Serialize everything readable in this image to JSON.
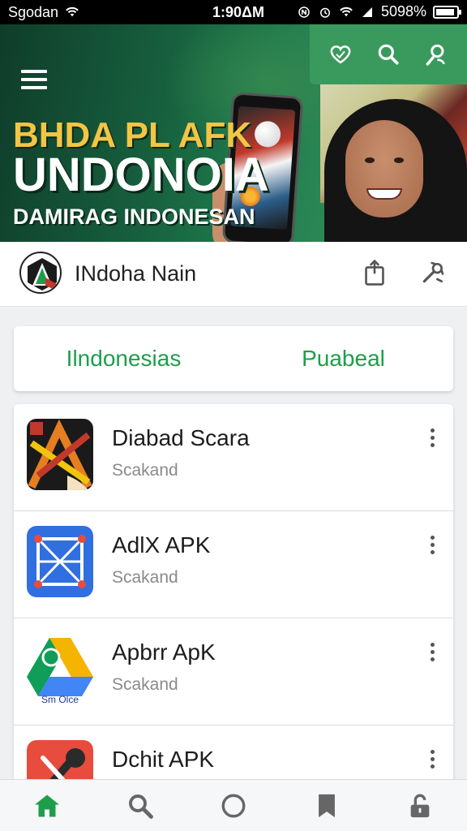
{
  "status_bar": {
    "carrier": "Sgodan",
    "time": "1:90ΔΜ",
    "battery": "5098%"
  },
  "banner": {
    "headline_line1": "BHDA PL AFK",
    "headline_line2": "UNDONOIA",
    "headline_line3": "DAMIRAG INDONESAN",
    "actions": [
      {
        "name": "favorite",
        "icon": "heart-icon"
      },
      {
        "name": "search",
        "icon": "search-icon"
      },
      {
        "name": "profile",
        "icon": "person-icon"
      }
    ]
  },
  "app_header": {
    "title": "INdoha Nain",
    "icons": [
      "share-icon",
      "tool-icon"
    ]
  },
  "tabs": [
    {
      "label": "Ilndonesias",
      "color": "#1e9e4a"
    },
    {
      "label": "Puabeal",
      "color": "#1e9e4a"
    }
  ],
  "apps": [
    {
      "name": "Diabad Scara",
      "subtitle": "Scakand",
      "icon": "game-icon"
    },
    {
      "name": "AdlX APK",
      "subtitle": "Scakand",
      "icon": "network-icon"
    },
    {
      "name": "Apbrr ApK",
      "subtitle": "Scakand",
      "icon_caption": "Sm Olce",
      "icon": "drive-icon"
    },
    {
      "name": "Dchit APK",
      "subtitle": "",
      "icon": "tools-icon"
    }
  ],
  "bottom_nav": [
    {
      "name": "home",
      "icon": "home-icon",
      "active": true
    },
    {
      "name": "search",
      "icon": "search-icon",
      "active": false
    },
    {
      "name": "circle",
      "icon": "circle-icon",
      "active": false
    },
    {
      "name": "bookmark",
      "icon": "bookmark-icon",
      "active": false
    },
    {
      "name": "lock",
      "icon": "lock-icon",
      "active": false
    }
  ],
  "colors": {
    "accent": "#1e9e4a",
    "banner_actions": "#3a9a5e",
    "headline_yellow": "#f3c544"
  }
}
